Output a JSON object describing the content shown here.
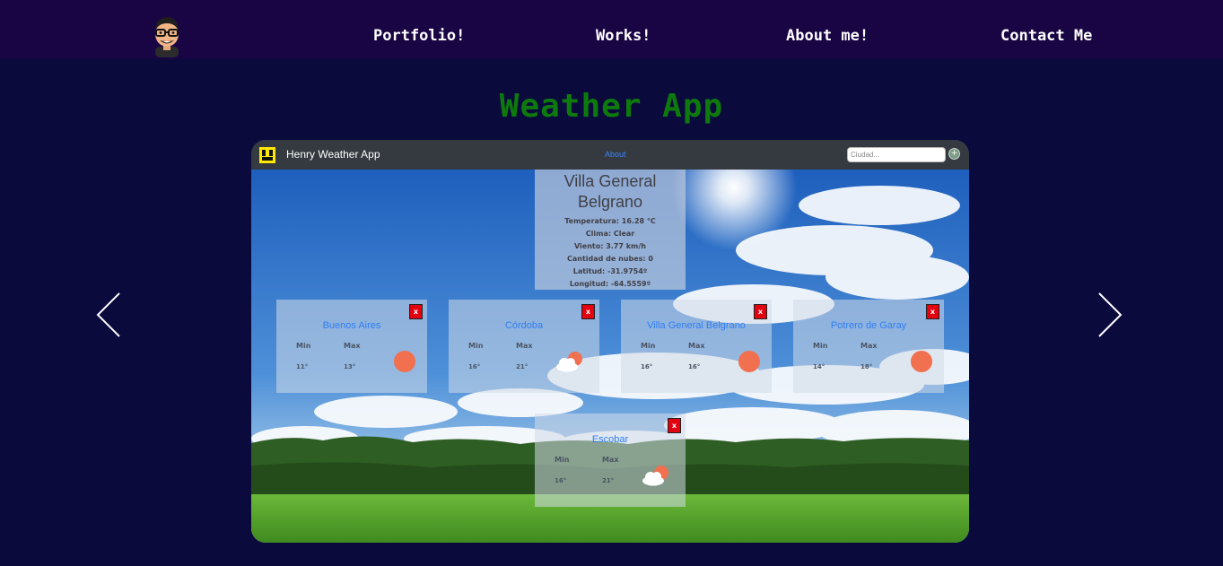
{
  "nav": {
    "links": [
      "Portfolio!",
      "Works!",
      "About me!",
      "Contact Me"
    ]
  },
  "page": {
    "title": "Weather App"
  },
  "app": {
    "brand": "Henry Weather App",
    "about": "About",
    "search_placeholder": "Ciudad...",
    "search_button": "+"
  },
  "detail": {
    "city": "Villa General Belgrano",
    "lines": [
      "Temperatura: 16.28 °C",
      "Clima: Clear",
      "Viento: 3.77 km/h",
      "Cantidad de nubes: 0",
      "Latitud: -31.9754º",
      "Longitud: -64.5559º"
    ]
  },
  "cards": [
    {
      "name": "Buenos Aires",
      "min_label": "Min",
      "max_label": "Max",
      "min": "11°",
      "max": "13°",
      "icon": "sun-icon"
    },
    {
      "name": "Córdoba",
      "min_label": "Min",
      "max_label": "Max",
      "min": "16°",
      "max": "21°",
      "icon": "partly-cloudy-icon"
    },
    {
      "name": "Villa General Belgrano",
      "min_label": "Min",
      "max_label": "Max",
      "min": "16°",
      "max": "16°",
      "icon": "sun-icon"
    },
    {
      "name": "Potrero de Garay",
      "min_label": "Min",
      "max_label": "Max",
      "min": "14°",
      "max": "18°",
      "icon": "sun-icon"
    },
    {
      "name": "Escobar",
      "min_label": "Min",
      "max_label": "Max",
      "min": "16°",
      "max": "21°",
      "icon": "partly-cloudy-icon"
    }
  ],
  "close_label": "x",
  "colors": {
    "background": "#0b0a3d",
    "nav_background": "#190444",
    "title": "#0e7a0e",
    "app_bar": "#343a40",
    "city_link": "#2f7ef2",
    "close_button": "#e3000f",
    "sun": "#f0704f"
  }
}
